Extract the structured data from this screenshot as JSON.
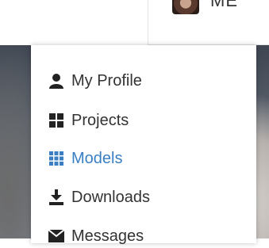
{
  "header": {
    "user_name": "ME"
  },
  "menu": {
    "accent_color": "#3a7fc4",
    "items": [
      {
        "label": "My Profile",
        "icon": "user-icon",
        "active": false
      },
      {
        "label": "Projects",
        "icon": "grid-2x2-icon",
        "active": false
      },
      {
        "label": "Models",
        "icon": "grid-3x3-icon",
        "active": true
      },
      {
        "label": "Downloads",
        "icon": "download-icon",
        "active": false
      },
      {
        "label": "Messages",
        "icon": "envelope-icon",
        "active": false
      }
    ]
  }
}
